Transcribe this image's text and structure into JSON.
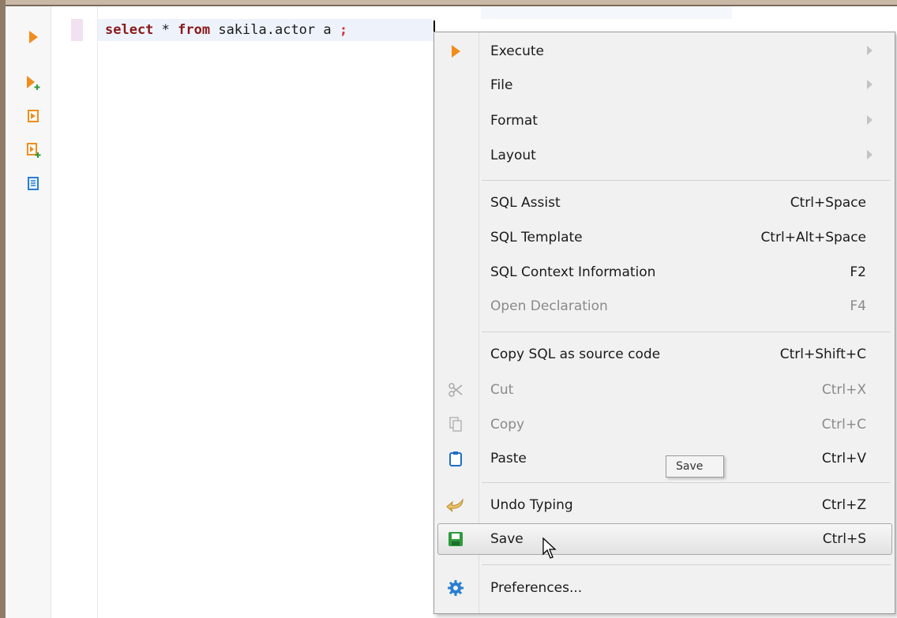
{
  "editor": {
    "code_kw_select": "select",
    "code_star": " * ",
    "code_kw_from": "from",
    "code_rest": " sakila.actor a ",
    "code_semicolon": ";"
  },
  "toolbar": {
    "buttons": [
      "execute-icon",
      "execute-new-tab-icon",
      "execute-script-icon",
      "execute-script-new-tab-icon",
      "explain-plan-icon"
    ]
  },
  "context_menu": {
    "items": [
      {
        "label": "Execute",
        "shortcut": "",
        "submenu": true,
        "icon": "execute-icon",
        "enabled": true
      },
      {
        "label": "File",
        "shortcut": "",
        "submenu": true,
        "icon": "",
        "enabled": true
      },
      {
        "label": "Format",
        "shortcut": "",
        "submenu": true,
        "icon": "",
        "enabled": true
      },
      {
        "label": "Layout",
        "shortcut": "",
        "submenu": true,
        "icon": "",
        "enabled": true
      },
      {
        "label": "SQL Assist",
        "shortcut": "Ctrl+Space",
        "icon": "",
        "enabled": true
      },
      {
        "label": "SQL Template",
        "shortcut": "Ctrl+Alt+Space",
        "icon": "",
        "enabled": true
      },
      {
        "label": "SQL Context Information",
        "shortcut": "F2",
        "icon": "",
        "enabled": true
      },
      {
        "label": "Open Declaration",
        "shortcut": "F4",
        "icon": "",
        "enabled": false
      },
      {
        "label": "Copy SQL as source code",
        "shortcut": "Ctrl+Shift+C",
        "icon": "",
        "enabled": true
      },
      {
        "label": "Cut",
        "shortcut": "Ctrl+X",
        "icon": "scissors-icon",
        "enabled": false
      },
      {
        "label": "Copy",
        "shortcut": "Ctrl+C",
        "icon": "copy-icon",
        "enabled": false
      },
      {
        "label": "Paste",
        "shortcut": "Ctrl+V",
        "icon": "clipboard-icon",
        "enabled": true
      },
      {
        "label": "Undo Typing",
        "shortcut": "Ctrl+Z",
        "icon": "undo-icon",
        "enabled": true
      },
      {
        "label": "Save",
        "shortcut": "Ctrl+S",
        "icon": "save-icon",
        "enabled": true,
        "highlighted": true
      },
      {
        "label": "Preferences...",
        "shortcut": "",
        "icon": "gear-icon",
        "enabled": true
      }
    ]
  },
  "tooltip": {
    "text": "Save"
  },
  "colors": {
    "accent_orange": "#f28c1c",
    "keyword": "#8b1a1a",
    "save_green": "#2e9a3e",
    "gear_blue": "#2a7fd0"
  }
}
